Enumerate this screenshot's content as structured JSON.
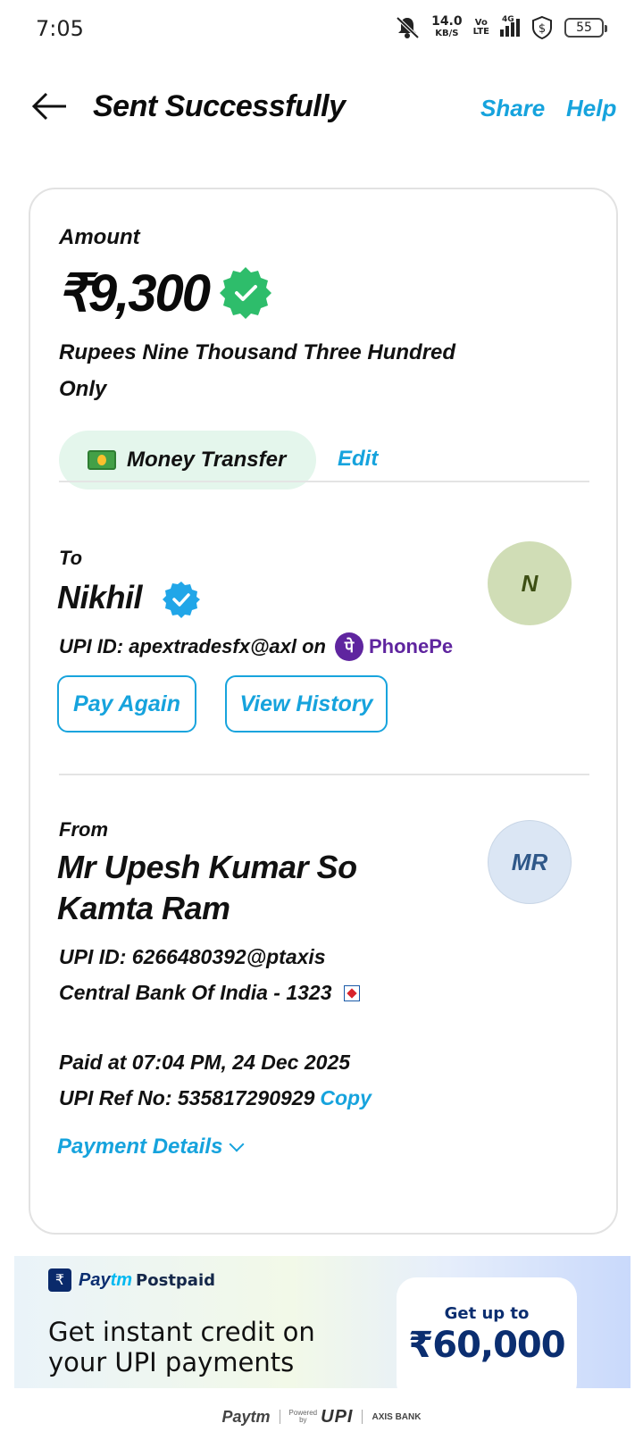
{
  "status_bar": {
    "time": "7:05",
    "net_speed": "14.0",
    "net_unit": "KB/S",
    "volte_top": "Vo",
    "volte_bottom": "LTE",
    "network": "4G",
    "battery": "55"
  },
  "header": {
    "title": "Sent Successfully",
    "share": "Share",
    "help": "Help"
  },
  "amount": {
    "label": "Amount",
    "value": "₹9,300",
    "words": "Rupees Nine Thousand Three Hundred Only"
  },
  "category": {
    "label": "Money Transfer",
    "edit": "Edit"
  },
  "recipient": {
    "label": "To",
    "name": "Nikhil",
    "upi_text": "UPI ID: apextradesfx@axl on",
    "app": "PhonePe",
    "app_mark": "पे",
    "avatar": "N"
  },
  "actions": {
    "pay_again": "Pay Again",
    "view_history": "View History"
  },
  "sender": {
    "label": "From",
    "name": "Mr Upesh Kumar So Kamta Ram",
    "upi": "UPI ID: 6266480392@ptaxis",
    "bank": "Central Bank Of India - 1323",
    "avatar": "MR"
  },
  "transaction": {
    "paid_at": "Paid at 07:04 PM, 24 Dec 2025",
    "ref_no": "UPI Ref No: 535817290929",
    "copy": "Copy",
    "details": "Payment Details"
  },
  "banner": {
    "brand_pay": "Pay",
    "brand_tm": "tm",
    "brand_postpaid": "Postpaid",
    "wallet_symbol": "₹",
    "headline": "Get instant credit on your UPI payments",
    "offer_label": "Get up to",
    "offer_value": "₹60,000"
  },
  "footer": {
    "paytm": "Paytm",
    "powered": "Powered",
    "by": "by",
    "upi": "UPI",
    "bank": "AXIS BANK"
  },
  "colors": {
    "accent": "#16a3dd",
    "success": "#2ebd6b",
    "phonepe": "#5f259f"
  }
}
